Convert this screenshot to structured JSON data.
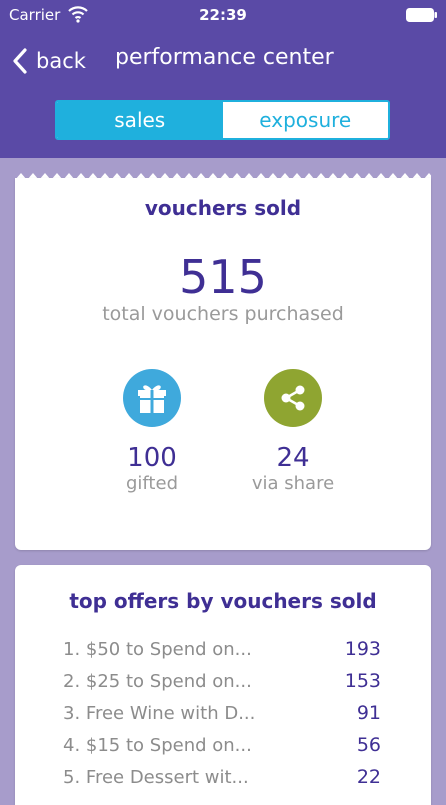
{
  "status_bar": {
    "carrier": "Carrier",
    "time": "22:39",
    "wifi_icon": "wifi-icon",
    "battery_icon": "battery-icon"
  },
  "nav": {
    "back_label": "back",
    "title": "performance center"
  },
  "segments": {
    "sales": "sales",
    "exposure": "exposure",
    "selected": "sales"
  },
  "vouchers": {
    "title": "vouchers sold",
    "total": "515",
    "total_label": "total vouchers purchased",
    "gifted": {
      "value": "100",
      "label": "gifted",
      "icon": "gift-icon",
      "color": "#3fa9dc"
    },
    "shared": {
      "value": "24",
      "label": "via share",
      "icon": "share-icon",
      "color": "#8fa531"
    }
  },
  "top_offers": {
    "title": "top offers by vouchers sold",
    "rows": [
      {
        "name": "1. $50 to Spend on...",
        "count": "193"
      },
      {
        "name": "2. $25 to Spend on...",
        "count": "153"
      },
      {
        "name": "3. Free Wine with D...",
        "count": "91"
      },
      {
        "name": "4. $15 to Spend on...",
        "count": "56"
      },
      {
        "name": "5. Free Dessert wit...",
        "count": "22"
      }
    ]
  },
  "colors": {
    "header": "#5a4aa6",
    "background": "#a79ccb",
    "accent": "#1fb0dd",
    "text_primary": "#3f2f94"
  }
}
